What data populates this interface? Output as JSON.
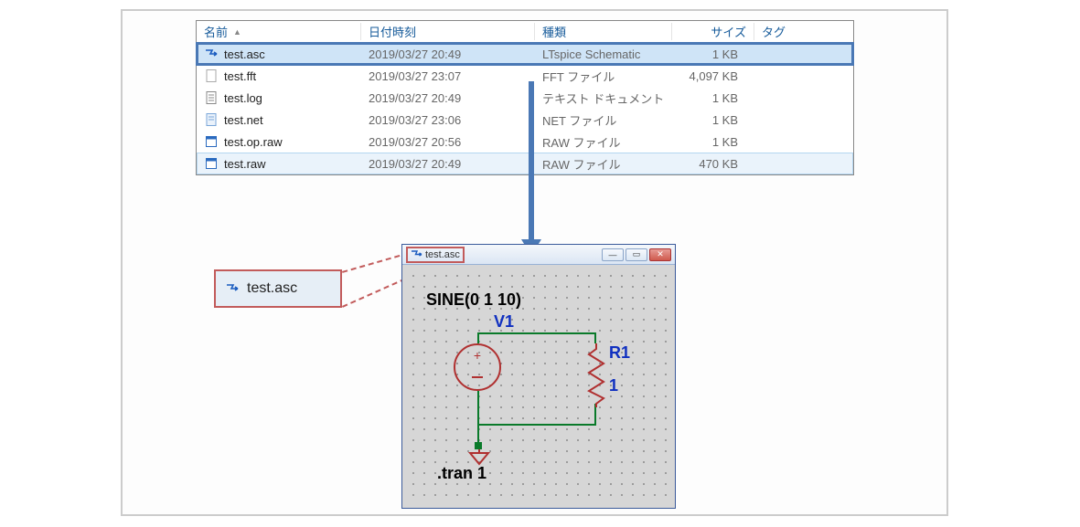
{
  "explorer": {
    "columns": {
      "name": "名前",
      "date": "日付時刻",
      "type": "種類",
      "size": "サイズ",
      "tag": "タグ"
    },
    "rows": [
      {
        "icon": "ltspice",
        "name": "test.asc",
        "date": "2019/03/27 20:49",
        "type": "LTspice Schematic",
        "size": "1 KB",
        "sel": "blue-thick"
      },
      {
        "icon": "blank",
        "name": "test.fft",
        "date": "2019/03/27 23:07",
        "type": "FFT ファイル",
        "size": "4,097 KB",
        "sel": ""
      },
      {
        "icon": "textdoc",
        "name": "test.log",
        "date": "2019/03/27 20:49",
        "type": "テキスト ドキュメント",
        "size": "1 KB",
        "sel": ""
      },
      {
        "icon": "note",
        "name": "test.net",
        "date": "2019/03/27 23:06",
        "type": "NET ファイル",
        "size": "1 KB",
        "sel": ""
      },
      {
        "icon": "raw",
        "name": "test.op.raw",
        "date": "2019/03/27 20:56",
        "type": "RAW ファイル",
        "size": "1 KB",
        "sel": ""
      },
      {
        "icon": "raw",
        "name": "test.raw",
        "date": "2019/03/27 20:49",
        "type": "RAW ファイル",
        "size": "470 KB",
        "sel": "light"
      }
    ]
  },
  "callout": {
    "label": "test.asc"
  },
  "schematic": {
    "title": "test.asc",
    "labels": {
      "sine": "SINE(0 1 10)",
      "v1": "V1",
      "r1": "R1",
      "r1val": "1",
      "tran": ".tran 1"
    }
  }
}
